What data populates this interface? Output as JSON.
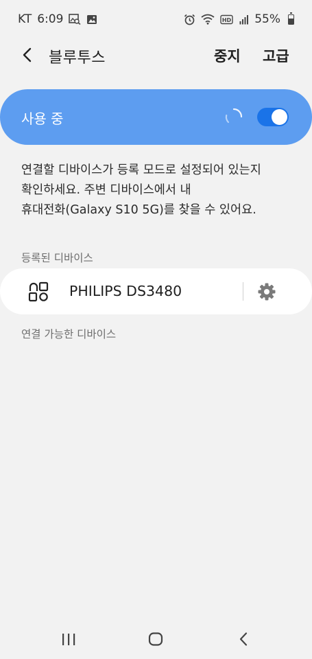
{
  "status_bar": {
    "carrier": "KT",
    "time": "6:09",
    "battery": "55%",
    "left_icons": [
      "gallery-search-icon",
      "image-icon"
    ],
    "right_icons": [
      "alarm-icon",
      "wifi-icon",
      "hd-icon",
      "signal-icon",
      "battery-icon"
    ]
  },
  "app_bar": {
    "title": "블루투스",
    "stop_label": "중지",
    "advanced_label": "고급"
  },
  "toggle": {
    "label": "사용 중",
    "state": "on",
    "accent_color": "#5d9df0",
    "switch_color": "#1a73e8"
  },
  "description": {
    "line1": "연결할 디바이스가 등록 모드로 설정되어 있는지",
    "line2": "확인하세요. 주변 디바이스에서 내",
    "line3": "휴대전화(Galaxy S10 5G)를 찾을 수 있어요."
  },
  "registered": {
    "header": "등록된 디바이스",
    "devices": [
      {
        "name": "PHILIPS DS3480",
        "icon": "speaker-icon"
      }
    ]
  },
  "available": {
    "header": "연결 가능한 디바이스"
  },
  "nav": {
    "icons": [
      "recent-apps-icon",
      "home-icon",
      "back-icon"
    ]
  }
}
